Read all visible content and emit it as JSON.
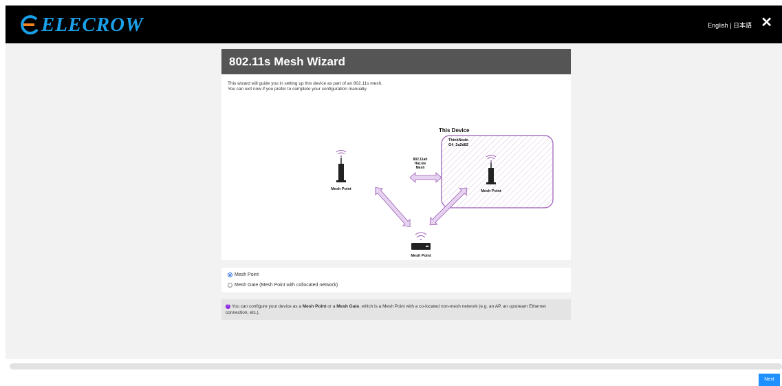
{
  "header": {
    "logo_text": "ELECROW",
    "lang_english": "English",
    "lang_separator": "|",
    "lang_japanese": "日本語",
    "close_label": "✕"
  },
  "wizard": {
    "title": "802.11s Mesh Wizard",
    "intro_line1": "This wizard will guide you in setting up this device as part of an 802.11s mesh.",
    "intro_line2": "You can exit now if you prefer to complete your configuration manually."
  },
  "diagram": {
    "this_device_label": "This Device",
    "device_name_line1": "ThinkNode-",
    "device_name_line2": "G4_2a2d82",
    "link_label_line1": "802.11ah",
    "link_label_line2": "HaLow",
    "link_label_line3": "Mesh",
    "mesh_point_left": "Mesh Point",
    "mesh_point_right": "Mesh Point",
    "mesh_point_bottom": "Mesh Point",
    "accent_color": "#9b59b6",
    "arrow_fill": "#e6d3f0"
  },
  "options": {
    "mesh_point": "Mesh Point",
    "mesh_gate": "Mesh Gate (Mesh Point with collocated network)",
    "selected": "Mesh Point"
  },
  "info": {
    "text_1": "You can configure your device as a ",
    "bold_1": "Mesh Point",
    "text_2": " or a ",
    "bold_2": "Mesh Gate",
    "text_3": ", which is a Mesh Point with a co-located non-mesh network (e.g. an AP, an upstream Ethernet connection, etc.)."
  },
  "footer": {
    "next_label": "Next"
  },
  "colors": {
    "header_bg": "#000000",
    "logo_blue": "#1aa0e8",
    "title_bar": "#555555",
    "next_button": "#1e90ff"
  }
}
